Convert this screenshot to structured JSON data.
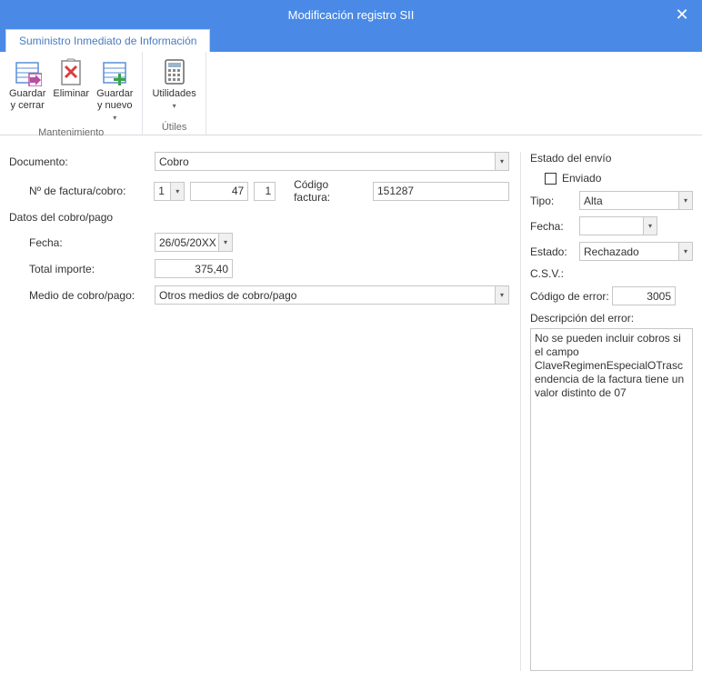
{
  "window": {
    "title": "Modificación registro SII",
    "close_glyph": "✕"
  },
  "ribbon": {
    "tab": "Suministro Inmediato de Información",
    "groups": {
      "mantenimiento": {
        "label": "Mantenimiento",
        "guardar_cerrar": "Guardar\ny cerrar",
        "eliminar": "Eliminar",
        "guardar_nuevo": "Guardar\ny nuevo"
      },
      "utiles": {
        "label": "Útiles",
        "utilidades": "Utilidades"
      }
    }
  },
  "form": {
    "documento_label": "Documento:",
    "documento_value": "Cobro",
    "numero_label": "Nº de factura/cobro:",
    "numero_serie": "1",
    "numero_num": "47",
    "numero_sub": "1",
    "codigo_factura_label": "Código factura:",
    "codigo_factura_value": "151287",
    "datos_section": "Datos del cobro/pago",
    "fecha_label": "Fecha:",
    "fecha_value": "26/05/20XX",
    "total_label": "Total importe:",
    "total_value": "375,40",
    "medio_label": "Medio de cobro/pago:",
    "medio_value": "Otros medios de cobro/pago"
  },
  "envio": {
    "section": "Estado del envío",
    "enviado_label": "Enviado",
    "enviado_checked": false,
    "tipo_label": "Tipo:",
    "tipo_value": "Alta",
    "fecha_label": "Fecha:",
    "fecha_value": "",
    "estado_label": "Estado:",
    "estado_value": "Rechazado",
    "csv_label": "C.S.V.:",
    "csv_value": "",
    "codigo_error_label": "Código de error:",
    "codigo_error_value": "3005",
    "desc_error_label": "Descripción del error:",
    "desc_error_value": "No se pueden incluir cobros si el campo ClaveRegimenEspecialOTrascendencia de la factura tiene un valor distinto de 07"
  }
}
